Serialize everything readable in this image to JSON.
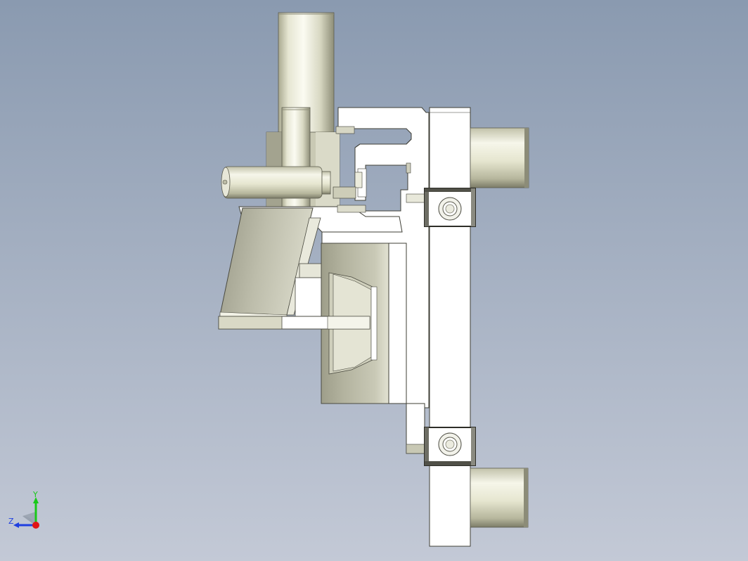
{
  "viewport": {
    "background_top": "#8a9ab0",
    "background_bottom": "#c3c9d6"
  },
  "triad": {
    "y_label": "Y",
    "z_label": "Z",
    "y_color": "#19c919",
    "z_color": "#1f3fe0",
    "x_color": "#e01515"
  },
  "colors": {
    "part_white": "#ffffff",
    "part_light": "#f4f4ec",
    "part_tan_mid": "#d2d2c0",
    "part_tan_dark": "#a8a894",
    "edge": "#3a3a32",
    "shadow": "#6d6d64"
  }
}
